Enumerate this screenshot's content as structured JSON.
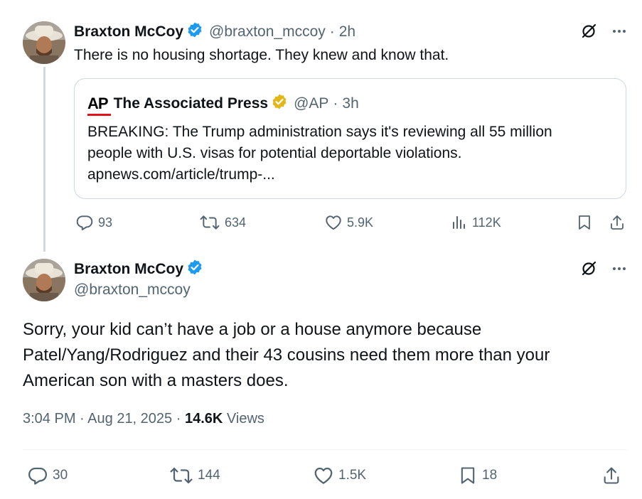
{
  "reply_tweet": {
    "author_name": "Braxton McCoy",
    "handle": "@braxton_mccoy",
    "dot": "·",
    "time": "2h",
    "text": "There is no housing shortage. They knew and know that.",
    "quote": {
      "logo_text": "AP",
      "author_name": "The Associated Press",
      "handle": "@AP",
      "dot": "·",
      "time": "3h",
      "text_line1": "BREAKING: The Trump administration says it's reviewing all 55 million",
      "text_line2": "people with U.S. visas for potential deportable violations.",
      "text_line3": "apnews.com/article/trump-..."
    },
    "actions": {
      "replies": "93",
      "reposts": "634",
      "likes": "5.9K",
      "views": "112K"
    }
  },
  "main_tweet": {
    "author_name": "Braxton McCoy",
    "handle": "@braxton_mccoy",
    "text_line1": "Sorry, your kid can’t have a job or a house anymore because",
    "text_line2": "Patel/Yang/Rodriguez and their 43 cousins need them more than your",
    "text_line3": "American son with a masters does.",
    "time": "3:04 PM",
    "dot": "·",
    "date": "Aug 21, 2025",
    "dot2": "·",
    "views_count": "14.6K",
    "views_label": "Views",
    "actions": {
      "replies": "30",
      "reposts": "144",
      "likes": "1.5K",
      "bookmarks": "18"
    }
  },
  "colors": {
    "text": "#0f1419",
    "muted": "#536471",
    "verified_blue": "#1d9bf0",
    "verified_gold": "#e2b719",
    "ap_red": "#e3131b",
    "border": "#cfd9de"
  },
  "icons": [
    "verified-badge-icon",
    "grok-icon",
    "more-icon",
    "reply-icon",
    "repost-icon",
    "like-icon",
    "views-icon",
    "bookmark-icon",
    "share-icon",
    "ap-logo"
  ]
}
